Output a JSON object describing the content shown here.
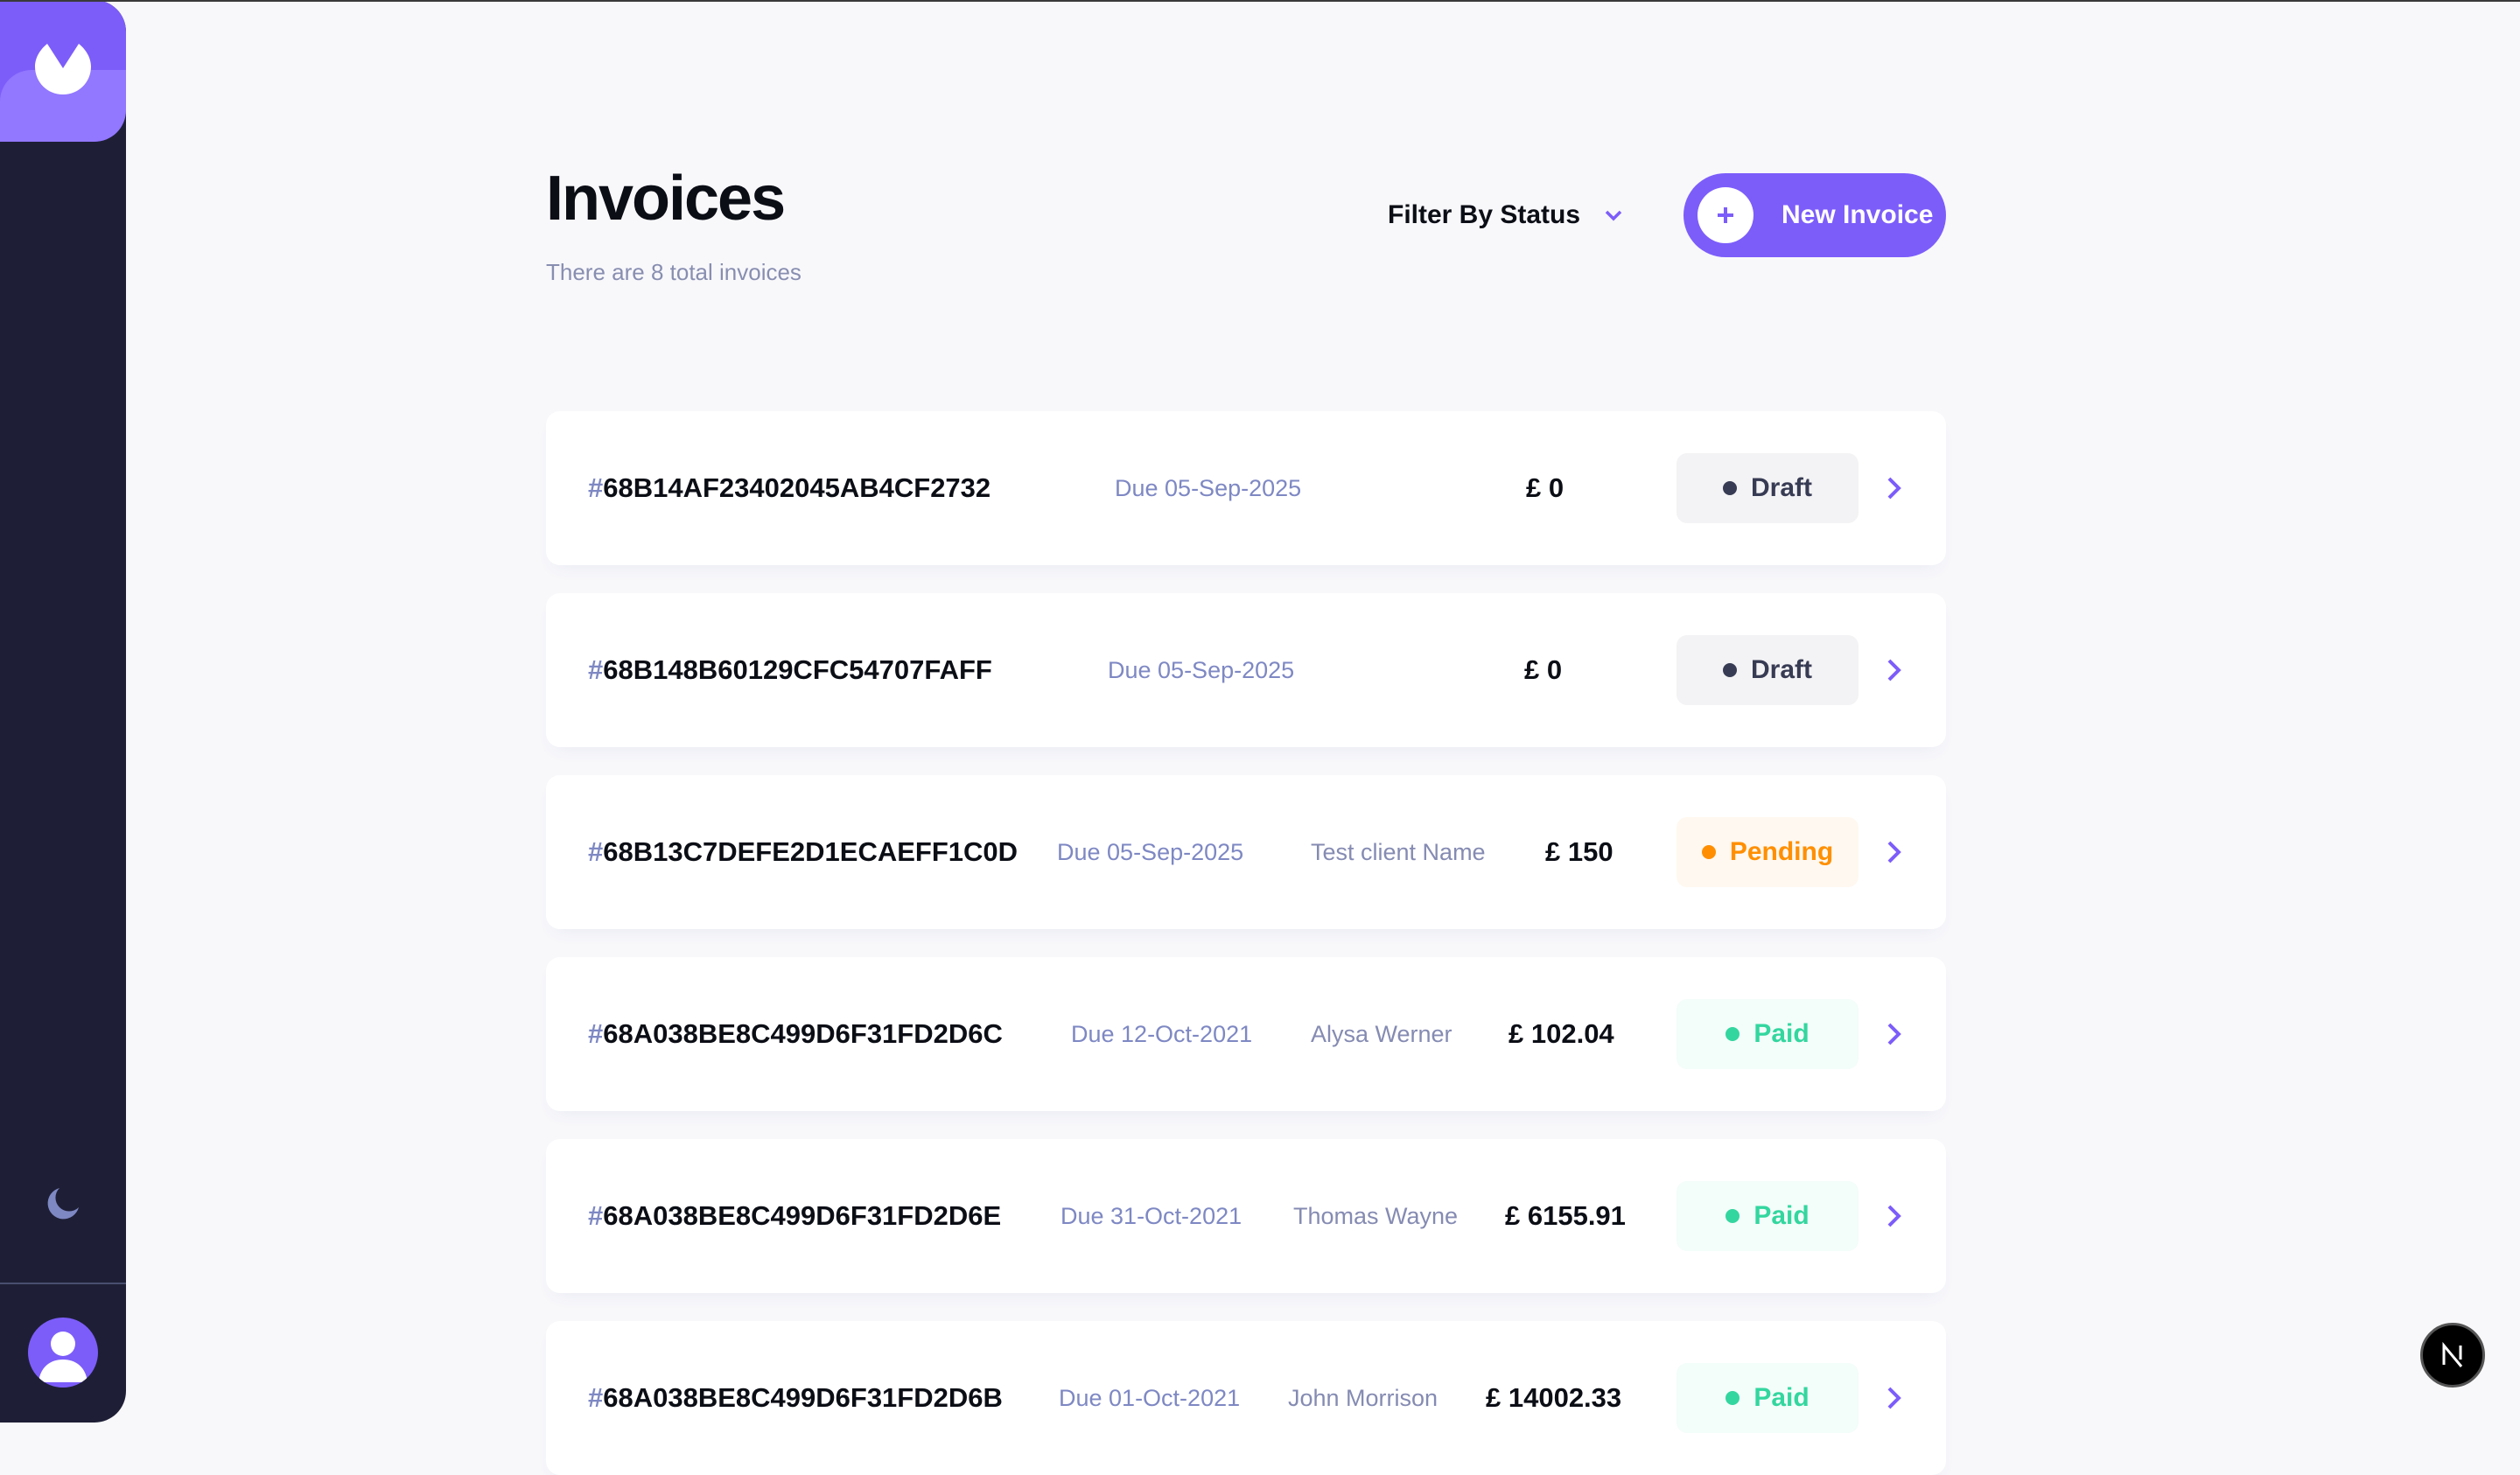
{
  "header": {
    "title": "Invoices",
    "subtitle": "There are 8 total invoices",
    "filter_label": "Filter By Status",
    "new_invoice_label": "New Invoice"
  },
  "invoices": [
    {
      "hash": "#",
      "id": "68B14AF23402045AB4CF2732",
      "due": "Due 05-Sep-2025",
      "client": "",
      "amount": "£ 0",
      "status": "Draft",
      "status_key": "draft"
    },
    {
      "hash": "#",
      "id": "68B148B60129CFC54707FAFF",
      "due": "Due 05-Sep-2025",
      "client": "",
      "amount": "£ 0",
      "status": "Draft",
      "status_key": "draft"
    },
    {
      "hash": "#",
      "id": "68B13C7DEFE2D1ECAEFF1C0D",
      "due": "Due 05-Sep-2025",
      "client": "Test client Name",
      "amount": "£ 150",
      "status": "Pending",
      "status_key": "pending"
    },
    {
      "hash": "#",
      "id": "68A038BE8C499D6F31FD2D6C",
      "due": "Due 12-Oct-2021",
      "client": "Alysa Werner",
      "amount": "£ 102.04",
      "status": "Paid",
      "status_key": "paid"
    },
    {
      "hash": "#",
      "id": "68A038BE8C499D6F31FD2D6E",
      "due": "Due 31-Oct-2021",
      "client": "Thomas Wayne",
      "amount": "£ 6155.91",
      "status": "Paid",
      "status_key": "paid"
    },
    {
      "hash": "#",
      "id": "68A038BE8C499D6F31FD2D6B",
      "due": "Due 01-Oct-2021",
      "client": "John Morrison",
      "amount": "£ 14002.33",
      "status": "Paid",
      "status_key": "paid"
    }
  ],
  "colors": {
    "accent": "#7c5dfa",
    "sidebar": "#1e1f36",
    "draft": "#373b53",
    "pending": "#ff8f00",
    "paid": "#33d69f"
  },
  "icons": {
    "logo": "logo-icon",
    "theme": "moon-icon",
    "avatar": "user-avatar",
    "filter": "chevron-down-icon",
    "add": "plus-icon",
    "row_arrow": "chevron-right-icon",
    "next": "nextjs-icon"
  }
}
